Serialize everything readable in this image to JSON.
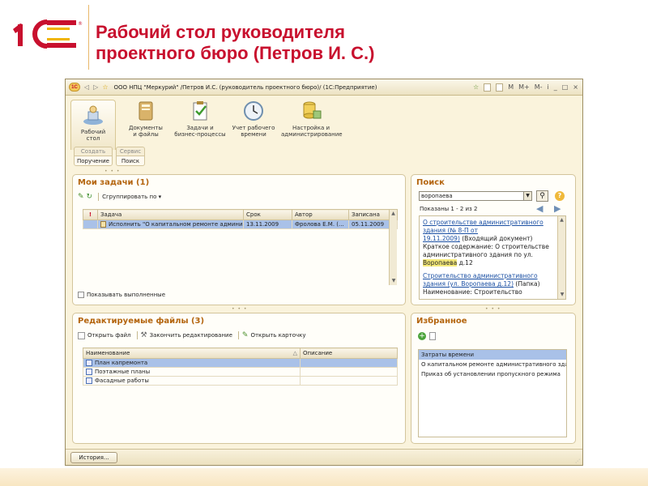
{
  "slide": {
    "title_line1": "Рабочий стол руководителя",
    "title_line2": "проектного бюро (Петров И. С.)",
    "logo_text": "1С",
    "logo_color": "#c8102e"
  },
  "window": {
    "title": "ООО НПЦ \"Меркурий\" /Петров И.С. (руководитель проектного бюро)/  (1С:Предприятие)",
    "app_icon_text": "1С",
    "controls": [
      "☆",
      "▦",
      "M",
      "M+",
      "M-",
      "i",
      "_",
      "□",
      "×"
    ]
  },
  "sections": [
    {
      "label_1": "Рабочий",
      "label_2": "стол",
      "icon": "desktop-icon"
    },
    {
      "label_1": "Документы",
      "label_2": "и файлы",
      "icon": "documents-icon"
    },
    {
      "label_1": "Задачи и",
      "label_2": "бизнес-процессы",
      "icon": "tasks-icon"
    },
    {
      "label_1": "Учет рабочего",
      "label_2": "времени",
      "icon": "clock-icon"
    },
    {
      "label_1": "Настройка и",
      "label_2": "администрирование",
      "icon": "database-icon"
    }
  ],
  "command_groups": [
    {
      "caption": "Создать",
      "button": "Поручение"
    },
    {
      "caption": "Сервис",
      "button": "Поиск"
    }
  ],
  "my_tasks": {
    "title": "Мои задачи (1)",
    "group_by": "Сгруппировать по ▾",
    "columns": [
      "!",
      "Задача",
      "Срок",
      "Автор",
      "Записана"
    ],
    "rows": [
      {
        "task": "Исполнить \"О капитальном ремонте админис...",
        "due": "13.11.2009",
        "author": "Фролова Е.М. (...",
        "recorded": "05.11.2009"
      }
    ],
    "show_completed": "Показывать выполненные"
  },
  "search": {
    "title": "Поиск",
    "query": "воропаева",
    "shown": "Показаны 1 - 2 из 2",
    "r1_link_a": "О строительстве административного",
    "r1_link_b": "здания (№ 8-П от",
    "r1_link_c": "19.11.2009)",
    "r1_type": " (Входящий документ)",
    "r1_summary_a": "Краткое содержание: О строительстве",
    "r1_summary_b": "административного здания по ул.",
    "r1_highlight": "Воропаева",
    "r1_summary_c": " д.12",
    "r2_link_a": "Строительство административного",
    "r2_link_b": "здания (ул. Воропаева д.12)",
    "r2_type": " (Папка)",
    "r2_summary": "Наименование: Строительство"
  },
  "edited_files": {
    "title": "Редактируемые файлы (3)",
    "toolbar": {
      "open_file": "Открыть файл",
      "finish_edit": "Закончить редактирование",
      "open_card": "Открыть карточку"
    },
    "columns": [
      "Наименование",
      "Описание"
    ],
    "rows": [
      {
        "name": "План капремонта",
        "description": ""
      },
      {
        "name": "Поэтажные планы",
        "description": ""
      },
      {
        "name": "Фасадные работы",
        "description": ""
      }
    ]
  },
  "favorites": {
    "title": "Избранное",
    "items": [
      "Затраты времени",
      "О капитальном ремонте административного зда...",
      "Приказ об установлении пропускного режима"
    ]
  },
  "bottom": {
    "history": "История..."
  }
}
